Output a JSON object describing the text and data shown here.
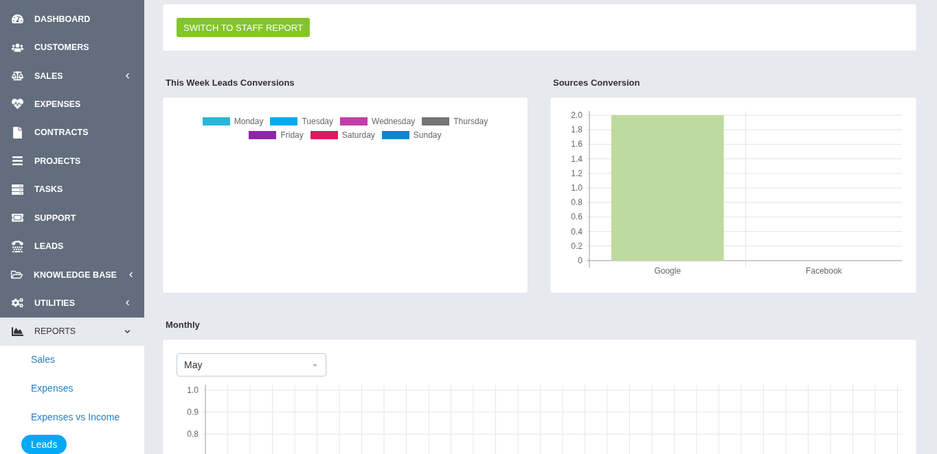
{
  "sidebar": {
    "items": [
      {
        "label": "DASHBOARD",
        "expandable": false,
        "expanded": false
      },
      {
        "label": "CUSTOMERS",
        "expandable": false,
        "expanded": false
      },
      {
        "label": "SALES",
        "expandable": true,
        "expanded": false
      },
      {
        "label": "EXPENSES",
        "expandable": false,
        "expanded": false
      },
      {
        "label": "CONTRACTS",
        "expandable": false,
        "expanded": false
      },
      {
        "label": "PROJECTS",
        "expandable": false,
        "expanded": false
      },
      {
        "label": "TASKS",
        "expandable": false,
        "expanded": false
      },
      {
        "label": "SUPPORT",
        "expandable": false,
        "expanded": false
      },
      {
        "label": "LEADS",
        "expandable": false,
        "expanded": false
      },
      {
        "label": "KNOWLEDGE BASE",
        "expandable": true,
        "expanded": false
      },
      {
        "label": "UTILITIES",
        "expandable": true,
        "expanded": false
      },
      {
        "label": "REPORTS",
        "expandable": true,
        "expanded": true,
        "children": [
          {
            "label": "Sales",
            "selected": false
          },
          {
            "label": "Expenses",
            "selected": false
          },
          {
            "label": "Expenses vs Income",
            "selected": false
          },
          {
            "label": "Leads",
            "selected": true
          }
        ]
      }
    ]
  },
  "switch_button": "SWITCH TO STAFF REPORT",
  "week_conversions": {
    "title": "This Week Leads Conversions",
    "legend": [
      {
        "label": "Monday",
        "color": "#29b6d8"
      },
      {
        "label": "Tuesday",
        "color": "#03a9f4"
      },
      {
        "label": "Wednesday",
        "color": "#c13ea9"
      },
      {
        "label": "Thursday",
        "color": "#757575"
      },
      {
        "label": "Friday",
        "color": "#8e24aa"
      },
      {
        "label": "Saturday",
        "color": "#d81b60"
      },
      {
        "label": "Sunday",
        "color": "#0288d1"
      }
    ]
  },
  "sources_conversion": {
    "title": "Sources Conversion",
    "chart_data": {
      "type": "bar",
      "categories": [
        "Google",
        "Facebook"
      ],
      "series": [
        {
          "color": "#bfdaa0",
          "values": [
            2,
            0
          ]
        }
      ],
      "grid": true,
      "ylim": [
        0,
        2
      ],
      "yticks": [
        {
          "value": 0,
          "label": "0"
        },
        {
          "value": 0.2,
          "label": "0.2"
        },
        {
          "value": 0.4,
          "label": "0.4"
        },
        {
          "value": 0.6,
          "label": "0.6"
        },
        {
          "value": 0.8,
          "label": "0.8"
        },
        {
          "value": 1,
          "label": "1.0"
        },
        {
          "value": 1.2,
          "label": "1.2"
        },
        {
          "value": 1.4,
          "label": "1.4"
        },
        {
          "value": 1.6,
          "label": "1.6"
        },
        {
          "value": 1.8,
          "label": "1.8"
        },
        {
          "value": 2,
          "label": "2.0"
        }
      ]
    }
  },
  "monthly": {
    "title": "Monthly",
    "month_select": {
      "value": "May"
    },
    "y_labels": [
      "1.0",
      "0.9",
      "0.8"
    ]
  }
}
